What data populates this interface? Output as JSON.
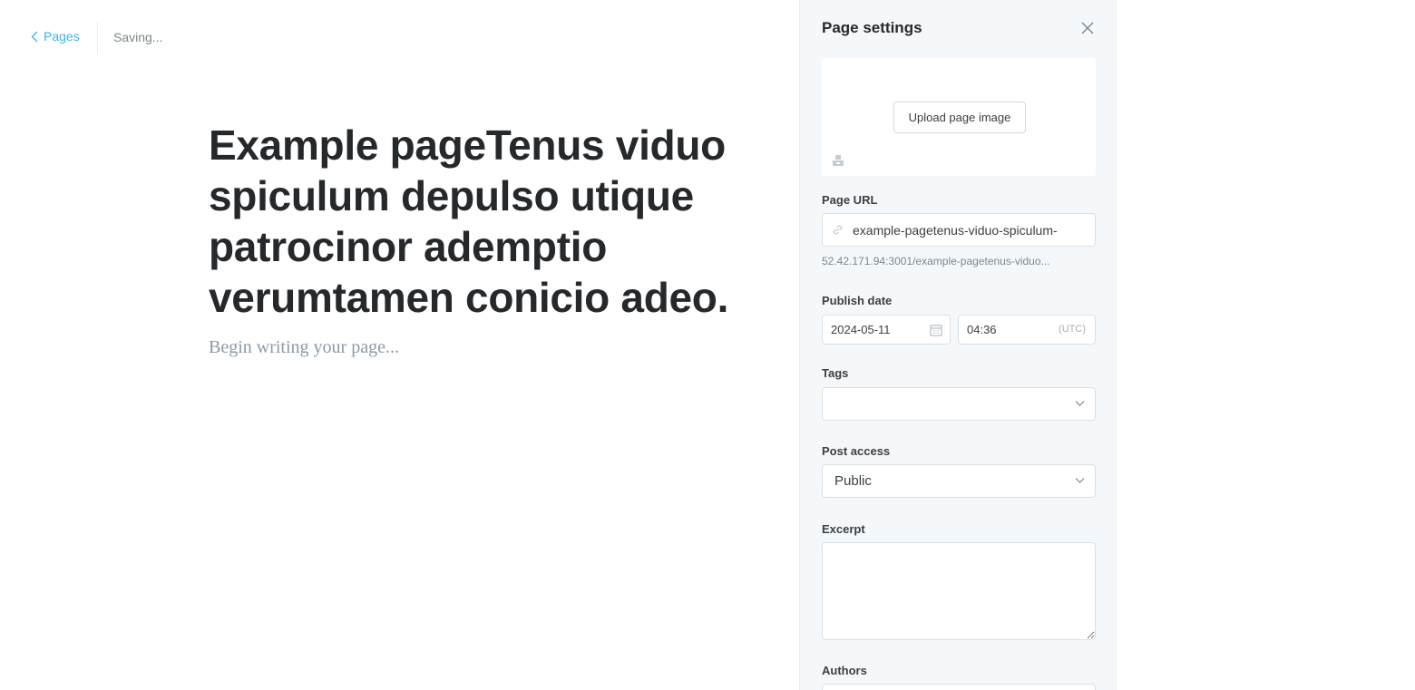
{
  "topbar": {
    "back_label": "Pages",
    "status": "Saving..."
  },
  "editor": {
    "title": "Example pageTenus viduo spiculum depulso utique patrocinor ademptio verumtamen conicio adeo.",
    "body_placeholder": "Begin writing your page..."
  },
  "settings": {
    "title": "Page settings",
    "upload_label": "Upload page image",
    "page_url_label": "Page URL",
    "page_url_value": "example-pagetenus-viduo-spiculum-",
    "page_url_hint": "52.42.171.94:3001/example-pagetenus-viduo...",
    "publish_date_label": "Publish date",
    "publish_date_value": "2024-05-11",
    "publish_time_value": "04:36",
    "timezone": "(UTC)",
    "tags_label": "Tags",
    "post_access_label": "Post access",
    "post_access_value": "Public",
    "excerpt_label": "Excerpt",
    "authors_label": "Authors"
  },
  "colors": {
    "accent": "#3eb0ef",
    "panel_bg": "#f5f8fb",
    "title_text": "#26292c"
  }
}
